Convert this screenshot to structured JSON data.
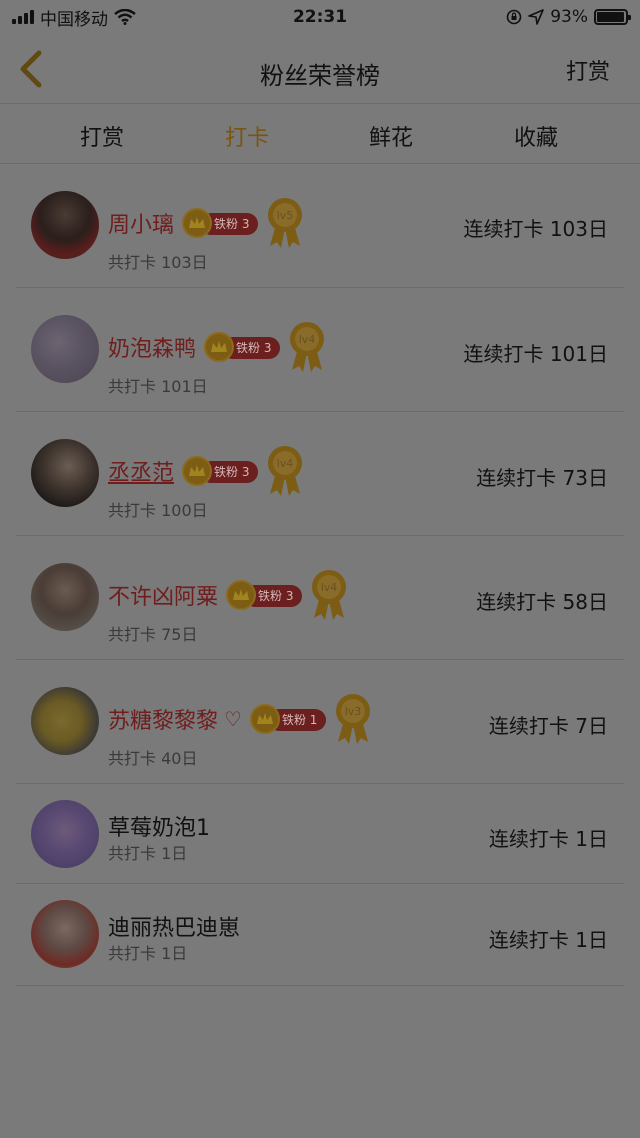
{
  "status_bar": {
    "carrier": "中国移动",
    "time": "22:31",
    "battery_percent": "93%"
  },
  "nav": {
    "title": "粉丝荣誉榜",
    "right_action": "打赏"
  },
  "tabs": [
    {
      "label": "打赏",
      "active": false
    },
    {
      "label": "打卡",
      "active": true
    },
    {
      "label": "鲜花",
      "active": false
    },
    {
      "label": "收藏",
      "active": false
    }
  ],
  "fans": [
    {
      "name": "周小璃",
      "fan_badge": "铁粉 3",
      "level": "lv5",
      "total": "共打卡 103日",
      "streak": "连续打卡 103日",
      "style": "red"
    },
    {
      "name": "奶泡森鸭",
      "fan_badge": "铁粉 3",
      "level": "lv4",
      "total": "共打卡 101日",
      "streak": "连续打卡 101日",
      "style": "red"
    },
    {
      "name": "丞丞范",
      "fan_badge": "铁粉 3",
      "level": "lv4",
      "total": "共打卡 100日",
      "streak": "连续打卡 73日",
      "style": "red-underline"
    },
    {
      "name": "不许凶阿粟",
      "fan_badge": "铁粉 3",
      "level": "lv4",
      "total": "共打卡 75日",
      "streak": "连续打卡 58日",
      "style": "red"
    },
    {
      "name": "苏糖黎黎黎",
      "heart": "♡",
      "fan_badge": "铁粉 1",
      "level": "lv3",
      "total": "共打卡 40日",
      "streak": "连续打卡 7日",
      "style": "red"
    },
    {
      "name": "草莓奶泡1",
      "total": "共打卡 1日",
      "streak": "连续打卡 1日",
      "style": "plain"
    },
    {
      "name": "迪丽热巴迪崽",
      "total": "共打卡 1日",
      "streak": "连续打卡 1日",
      "style": "plain"
    }
  ],
  "colors": {
    "accent_tab": "#7a5410",
    "fan_name": "#701d1d",
    "badge_pill": "#6b1f1f",
    "medal_gold": "#7d5c13"
  }
}
